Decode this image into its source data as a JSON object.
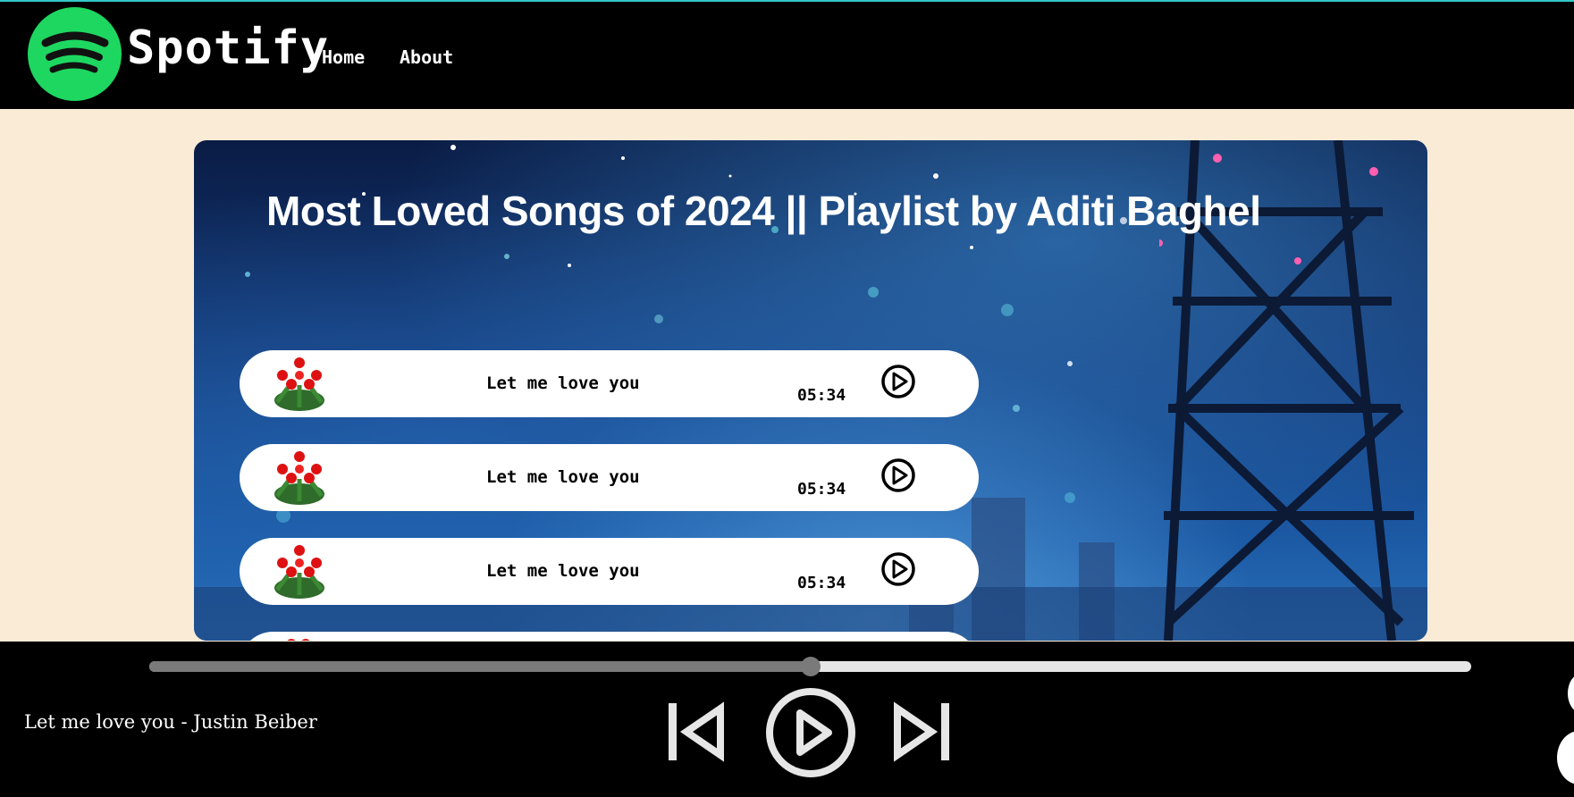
{
  "nav": {
    "brand": "Spotify",
    "links": [
      "Home",
      "About"
    ]
  },
  "playlist": {
    "title": "Most Loved Songs of 2024 || Playlist by Aditi Baghel",
    "songs": [
      {
        "name": "Let me love you",
        "duration": "05:34"
      },
      {
        "name": "Let me love you",
        "duration": "05:34"
      },
      {
        "name": "Let me love you",
        "duration": "05:34"
      },
      {
        "name": "",
        "duration": ""
      }
    ]
  },
  "player": {
    "now_playing": "Let me love you - Justin Beiber",
    "progress_percent": 50,
    "controls": [
      "previous-icon",
      "play-icon",
      "next-icon"
    ]
  },
  "colors": {
    "brand_green": "#1ed760",
    "navbar": "#000000",
    "page_background": "#faebd7",
    "seek_fill": "#7a7a7a",
    "seek_track": "#e6e6e6"
  }
}
